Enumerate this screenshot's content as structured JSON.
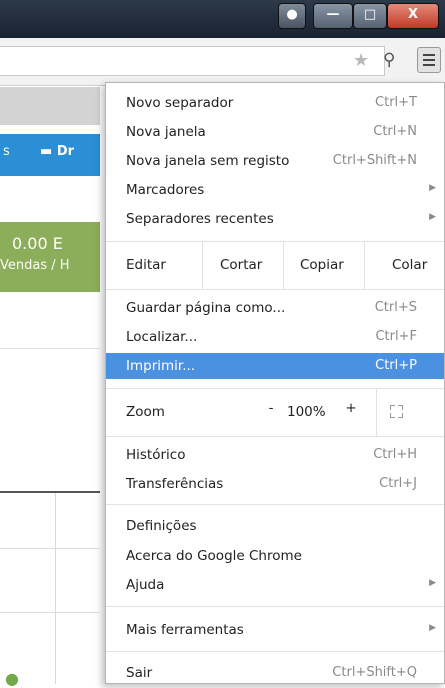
{
  "window": {
    "user_glyph": "●",
    "min_glyph": "—",
    "max_glyph": "□",
    "close_glyph": "X"
  },
  "toolbar": {
    "star_icon": "star-icon",
    "extension_icon": "extension-icon",
    "menu_icon": "hamburger-menu-icon"
  },
  "background_page": {
    "blue_bar_left": "s",
    "blue_bar_text": "Dr",
    "stat_value": "0.00 E",
    "stat_label": "Vendas / H"
  },
  "menu": {
    "group1": [
      {
        "label": "Novo separador",
        "shortcut": "Ctrl+T"
      },
      {
        "label": "Nova janela",
        "shortcut": "Ctrl+N"
      },
      {
        "label": "Nova janela sem registo",
        "shortcut": "Ctrl+Shift+N"
      },
      {
        "label": "Marcadores",
        "shortcut": ""
      },
      {
        "label": "Separadores recentes",
        "shortcut": ""
      }
    ],
    "edit": {
      "label": "Editar",
      "cut": "Cortar",
      "copy": "Copiar",
      "paste": "Colar"
    },
    "group2": [
      {
        "label": "Guardar página como...",
        "shortcut": "Ctrl+S"
      },
      {
        "label": "Localizar...",
        "shortcut": "Ctrl+F"
      },
      {
        "label": "Imprimir...",
        "shortcut": "Ctrl+P"
      }
    ],
    "zoom": {
      "label": "Zoom",
      "minus": "-",
      "level": "100%",
      "plus": "+"
    },
    "group3": [
      {
        "label": "Histórico",
        "shortcut": "Ctrl+H"
      },
      {
        "label": "Transferências",
        "shortcut": "Ctrl+J"
      }
    ],
    "group4": [
      {
        "label": "Definições",
        "shortcut": ""
      },
      {
        "label": "Acerca do Google Chrome",
        "shortcut": ""
      },
      {
        "label": "Ajuda",
        "shortcut": ""
      }
    ],
    "more_tools": "Mais ferramentas",
    "exit": {
      "label": "Sair",
      "shortcut": "Ctrl+Shift+Q"
    },
    "highlight_color": "#4b91e2"
  }
}
